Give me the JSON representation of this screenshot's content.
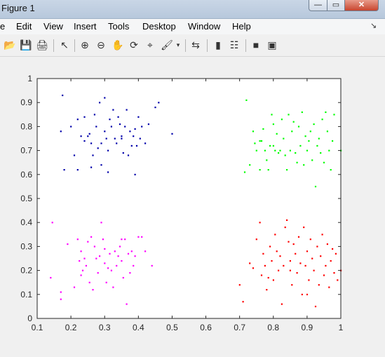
{
  "window": {
    "title": "Figure 1",
    "min_glyph": "—",
    "max_glyph": "▭",
    "close_glyph": "✕"
  },
  "menu": {
    "items": [
      "e",
      "Edit",
      "View",
      "Insert",
      "Tools",
      "Desktop",
      "Window",
      "Help"
    ],
    "dock_glyph": "↘"
  },
  "toolbar": {
    "icons": [
      "open-folder-icon",
      "save-icon",
      "print-icon",
      "pointer-icon",
      "zoom-in-icon",
      "zoom-out-icon",
      "pan-hand-icon",
      "rotate-3d-icon",
      "data-cursor-icon",
      "brush-icon",
      "link-plot-icon",
      "colorbar-icon",
      "legend-icon",
      "hide-plot-tools-icon",
      "show-plot-tools-icon"
    ],
    "glyphs": [
      "📂",
      "💾",
      "🖨",
      "↖",
      "⊕",
      "⊖",
      "✋",
      "⟳",
      "⌖",
      "🖌",
      "⇆",
      "▮",
      "☷",
      "■",
      "▣"
    ]
  },
  "chart_data": {
    "type": "scatter",
    "title": "",
    "xlabel": "",
    "ylabel": "",
    "xlim": [
      0.1,
      1
    ],
    "ylim": [
      0,
      1
    ],
    "xticks": [
      "0.1",
      "0.2",
      "0.3",
      "0.4",
      "0.5",
      "0.6",
      "0.7",
      "0.8",
      "0.9",
      "1"
    ],
    "yticks": [
      "0",
      "0.1",
      "0.2",
      "0.3",
      "0.4",
      "0.5",
      "0.6",
      "0.7",
      "0.8",
      "0.9",
      "1"
    ],
    "grid": false,
    "series": [
      {
        "color": "#0000aa",
        "points": [
          [
            0.175,
            0.93
          ],
          [
            0.17,
            0.78
          ],
          [
            0.2,
            0.8
          ],
          [
            0.21,
            0.68
          ],
          [
            0.22,
            0.83
          ],
          [
            0.23,
            0.76
          ],
          [
            0.24,
            0.84
          ],
          [
            0.25,
            0.76
          ],
          [
            0.255,
            0.77
          ],
          [
            0.26,
            0.73
          ],
          [
            0.265,
            0.68
          ],
          [
            0.27,
            0.85
          ],
          [
            0.275,
            0.8
          ],
          [
            0.28,
            0.71
          ],
          [
            0.285,
            0.9
          ],
          [
            0.29,
            0.64
          ],
          [
            0.3,
            0.92
          ],
          [
            0.3,
            0.78
          ],
          [
            0.305,
            0.75
          ],
          [
            0.31,
            0.7
          ],
          [
            0.31,
            0.61
          ],
          [
            0.315,
            0.83
          ],
          [
            0.32,
            0.8
          ],
          [
            0.325,
            0.87
          ],
          [
            0.33,
            0.75
          ],
          [
            0.335,
            0.73
          ],
          [
            0.34,
            0.84
          ],
          [
            0.345,
            0.81
          ],
          [
            0.35,
            0.76
          ],
          [
            0.355,
            0.69
          ],
          [
            0.36,
            0.8
          ],
          [
            0.365,
            0.87
          ],
          [
            0.37,
            0.68
          ],
          [
            0.375,
            0.78
          ],
          [
            0.38,
            0.72
          ],
          [
            0.385,
            0.76
          ],
          [
            0.39,
            0.79
          ],
          [
            0.395,
            0.72
          ],
          [
            0.4,
            0.84
          ],
          [
            0.405,
            0.75
          ],
          [
            0.41,
            0.8
          ],
          [
            0.42,
            0.73
          ],
          [
            0.43,
            0.81
          ],
          [
            0.45,
            0.88
          ],
          [
            0.46,
            0.9
          ],
          [
            0.5,
            0.77
          ],
          [
            0.18,
            0.62
          ],
          [
            0.22,
            0.62
          ],
          [
            0.24,
            0.74
          ],
          [
            0.26,
            0.63
          ],
          [
            0.29,
            0.73
          ],
          [
            0.35,
            0.75
          ],
          [
            0.39,
            0.6
          ]
        ]
      },
      {
        "color": "#00ff00",
        "points": [
          [
            0.715,
            0.61
          ],
          [
            0.72,
            0.91
          ],
          [
            0.73,
            0.64
          ],
          [
            0.74,
            0.78
          ],
          [
            0.745,
            0.73
          ],
          [
            0.75,
            0.7
          ],
          [
            0.76,
            0.62
          ],
          [
            0.765,
            0.74
          ],
          [
            0.77,
            0.79
          ],
          [
            0.775,
            0.7
          ],
          [
            0.78,
            0.66
          ],
          [
            0.785,
            0.62
          ],
          [
            0.79,
            0.72
          ],
          [
            0.795,
            0.85
          ],
          [
            0.8,
            0.81
          ],
          [
            0.805,
            0.7
          ],
          [
            0.81,
            0.77
          ],
          [
            0.815,
            0.69
          ],
          [
            0.82,
            0.7
          ],
          [
            0.825,
            0.83
          ],
          [
            0.83,
            0.75
          ],
          [
            0.835,
            0.68
          ],
          [
            0.84,
            0.62
          ],
          [
            0.845,
            0.85
          ],
          [
            0.85,
            0.7
          ],
          [
            0.855,
            0.78
          ],
          [
            0.86,
            0.82
          ],
          [
            0.865,
            0.69
          ],
          [
            0.87,
            0.65
          ],
          [
            0.875,
            0.8
          ],
          [
            0.88,
            0.72
          ],
          [
            0.885,
            0.86
          ],
          [
            0.89,
            0.64
          ],
          [
            0.895,
            0.76
          ],
          [
            0.9,
            0.7
          ],
          [
            0.905,
            0.74
          ],
          [
            0.91,
            0.78
          ],
          [
            0.915,
            0.66
          ],
          [
            0.92,
            0.81
          ],
          [
            0.925,
            0.55
          ],
          [
            0.93,
            0.72
          ],
          [
            0.935,
            0.75
          ],
          [
            0.94,
            0.69
          ],
          [
            0.945,
            0.83
          ],
          [
            0.95,
            0.65
          ],
          [
            0.955,
            0.86
          ],
          [
            0.96,
            0.78
          ],
          [
            0.965,
            0.7
          ],
          [
            0.97,
            0.62
          ],
          [
            0.975,
            0.74
          ],
          [
            0.98,
            0.85
          ],
          [
            1.0,
            0.7
          ],
          [
            0.76,
            0.74
          ],
          [
            0.8,
            0.72
          ]
        ]
      },
      {
        "color": "#ff00ff",
        "points": [
          [
            0.145,
            0.4
          ],
          [
            0.14,
            0.17
          ],
          [
            0.17,
            0.11
          ],
          [
            0.17,
            0.08
          ],
          [
            0.19,
            0.31
          ],
          [
            0.21,
            0.13
          ],
          [
            0.22,
            0.33
          ],
          [
            0.225,
            0.24
          ],
          [
            0.23,
            0.28
          ],
          [
            0.235,
            0.2
          ],
          [
            0.24,
            0.25
          ],
          [
            0.245,
            0.22
          ],
          [
            0.25,
            0.32
          ],
          [
            0.255,
            0.15
          ],
          [
            0.26,
            0.34
          ],
          [
            0.265,
            0.12
          ],
          [
            0.27,
            0.3
          ],
          [
            0.275,
            0.25
          ],
          [
            0.28,
            0.19
          ],
          [
            0.285,
            0.26
          ],
          [
            0.29,
            0.4
          ],
          [
            0.295,
            0.33
          ],
          [
            0.3,
            0.29
          ],
          [
            0.305,
            0.15
          ],
          [
            0.31,
            0.21
          ],
          [
            0.315,
            0.27
          ],
          [
            0.32,
            0.2
          ],
          [
            0.325,
            0.13
          ],
          [
            0.33,
            0.28
          ],
          [
            0.335,
            0.22
          ],
          [
            0.34,
            0.26
          ],
          [
            0.345,
            0.3
          ],
          [
            0.35,
            0.24
          ],
          [
            0.355,
            0.17
          ],
          [
            0.36,
            0.33
          ],
          [
            0.365,
            0.06
          ],
          [
            0.37,
            0.27
          ],
          [
            0.375,
            0.19
          ],
          [
            0.38,
            0.28
          ],
          [
            0.385,
            0.22
          ],
          [
            0.39,
            0.26
          ],
          [
            0.4,
            0.34
          ],
          [
            0.41,
            0.34
          ],
          [
            0.42,
            0.28
          ],
          [
            0.44,
            0.22
          ],
          [
            0.23,
            0.18
          ],
          [
            0.3,
            0.23
          ],
          [
            0.35,
            0.33
          ]
        ]
      },
      {
        "color": "#ff0000",
        "points": [
          [
            0.7,
            0.14
          ],
          [
            0.71,
            0.07
          ],
          [
            0.73,
            0.23
          ],
          [
            0.74,
            0.21
          ],
          [
            0.75,
            0.33
          ],
          [
            0.76,
            0.4
          ],
          [
            0.765,
            0.18
          ],
          [
            0.77,
            0.27
          ],
          [
            0.775,
            0.22
          ],
          [
            0.78,
            0.12
          ],
          [
            0.785,
            0.17
          ],
          [
            0.79,
            0.3
          ],
          [
            0.795,
            0.24
          ],
          [
            0.8,
            0.16
          ],
          [
            0.805,
            0.35
          ],
          [
            0.81,
            0.28
          ],
          [
            0.815,
            0.2
          ],
          [
            0.82,
            0.26
          ],
          [
            0.825,
            0.06
          ],
          [
            0.83,
            0.22
          ],
          [
            0.835,
            0.38
          ],
          [
            0.84,
            0.41
          ],
          [
            0.845,
            0.32
          ],
          [
            0.85,
            0.24
          ],
          [
            0.855,
            0.14
          ],
          [
            0.86,
            0.31
          ],
          [
            0.865,
            0.27
          ],
          [
            0.87,
            0.19
          ],
          [
            0.875,
            0.34
          ],
          [
            0.88,
            0.23
          ],
          [
            0.885,
            0.1
          ],
          [
            0.89,
            0.38
          ],
          [
            0.895,
            0.22
          ],
          [
            0.9,
            0.28
          ],
          [
            0.905,
            0.16
          ],
          [
            0.91,
            0.33
          ],
          [
            0.915,
            0.25
          ],
          [
            0.92,
            0.2
          ],
          [
            0.925,
            0.05
          ],
          [
            0.93,
            0.3
          ],
          [
            0.935,
            0.14
          ],
          [
            0.94,
            0.26
          ],
          [
            0.945,
            0.35
          ],
          [
            0.95,
            0.18
          ],
          [
            0.955,
            0.22
          ],
          [
            0.96,
            0.31
          ],
          [
            0.965,
            0.13
          ],
          [
            0.97,
            0.24
          ],
          [
            0.975,
            0.29
          ],
          [
            0.98,
            0.19
          ],
          [
            0.985,
            0.27
          ],
          [
            0.99,
            0.16
          ],
          [
            1.0,
            0.2
          ],
          [
            0.85,
            0.2
          ],
          [
            0.9,
            0.1
          ]
        ]
      }
    ]
  }
}
